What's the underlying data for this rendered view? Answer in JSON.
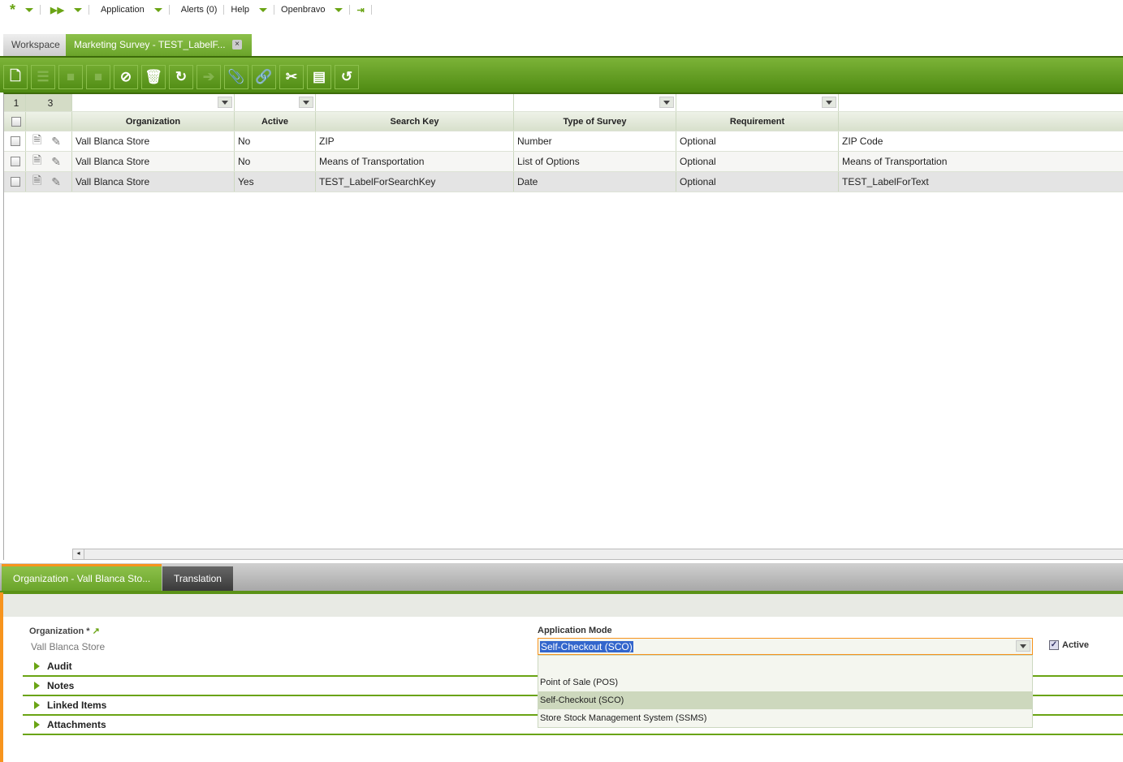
{
  "nav": {
    "application": "Application",
    "alerts": "Alerts (0)",
    "help": "Help",
    "user": "Openbravo"
  },
  "tabs": {
    "workspace": "Workspace",
    "active": "Marketing Survey - TEST_LabelF...",
    "close": "×"
  },
  "grid": {
    "filter_counts": [
      "1",
      "3"
    ],
    "columns": [
      "Organization",
      "Active",
      "Search Key",
      "Type of Survey",
      "Requirement",
      ""
    ],
    "rows": [
      [
        "Vall Blanca Store",
        "No",
        "ZIP",
        "Number",
        "Optional",
        "ZIP Code"
      ],
      [
        "Vall Blanca Store",
        "No",
        "Means of Transportation",
        "List of Options",
        "Optional",
        "Means of Transportation"
      ],
      [
        "Vall Blanca Store",
        "Yes",
        "TEST_LabelForSearchKey",
        "Date",
        "Optional",
        "TEST_LabelForText"
      ]
    ]
  },
  "subtabs": {
    "organization": "Organization - Vall Blanca Sto...",
    "translation": "Translation"
  },
  "form": {
    "org_label": "Organization *",
    "org_value": "Vall Blanca Store",
    "mode_label": "Application Mode",
    "mode_value": "Self-Checkout (SCO)",
    "mode_options": [
      "Point of Sale (POS)",
      "Self-Checkout (SCO)",
      "Store Stock Management System (SSMS)"
    ],
    "active_label": "Active",
    "sections": [
      "Audit",
      "Notes",
      "Linked Items",
      "Attachments"
    ]
  },
  "colors": {
    "accent": "#6aa414",
    "highlight": "#cdd8bd",
    "orange": "#f7941d"
  }
}
